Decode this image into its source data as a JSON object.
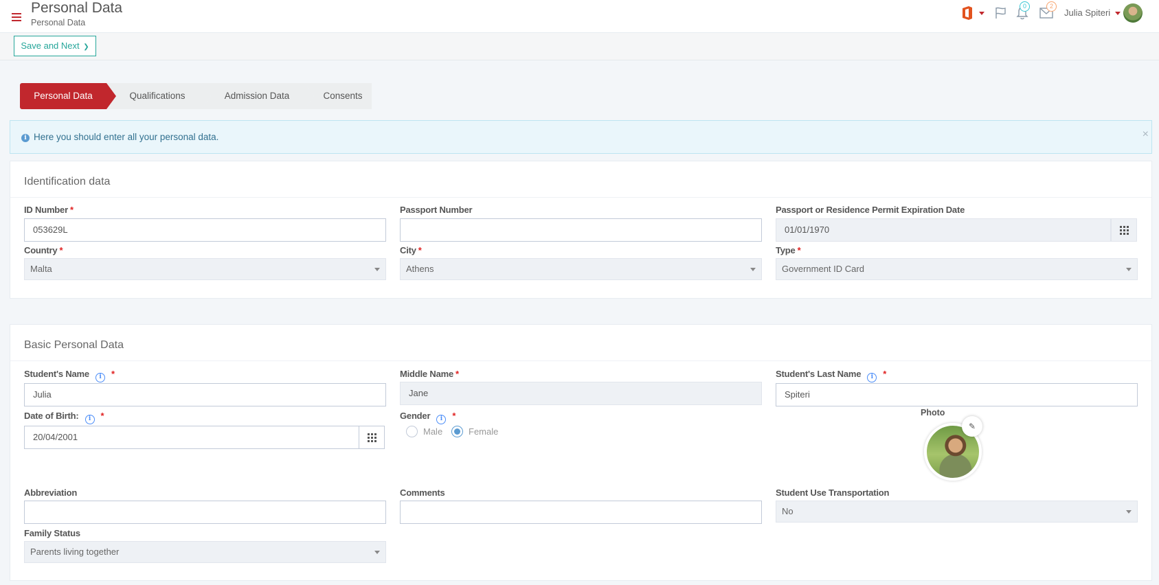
{
  "header": {
    "title": "Personal Data",
    "subtitle": "Personal Data",
    "notifications_count": "0",
    "messages_count": "2",
    "user_name": "Julia Spiteri",
    "icons": [
      "menu-icon",
      "office-icon",
      "flag-icon",
      "bell-icon",
      "mail-icon",
      "avatar"
    ]
  },
  "toolbar": {
    "save_next_label": "Save and Next",
    "save_next_glyph": "❯"
  },
  "steps": [
    {
      "label": "Personal Data",
      "active": true
    },
    {
      "label": "Qualifications",
      "active": false
    },
    {
      "label": "Admission Data",
      "active": false
    },
    {
      "label": "Consents",
      "active": false
    }
  ],
  "alert": {
    "text": "Here you should enter all your personal data.",
    "close": "×"
  },
  "identification": {
    "title": "Identification data",
    "id_number": {
      "label": "ID Number",
      "value": "053629L",
      "required": "*"
    },
    "passport_number": {
      "label": "Passport Number",
      "value": ""
    },
    "expiration": {
      "label": "Passport or Residence Permit Expiration Date",
      "value": "01/01/1970"
    },
    "country": {
      "label": "Country",
      "value": "Malta",
      "required": "*"
    },
    "city": {
      "label": "City",
      "value": "Athens",
      "required": "*"
    },
    "type": {
      "label": "Type",
      "value": "Government ID Card",
      "required": "*"
    }
  },
  "basic": {
    "title": "Basic Personal Data",
    "student_name": {
      "label": "Student's Name",
      "value": "Julia",
      "required": "*"
    },
    "middle_name": {
      "label": "Middle Name",
      "value": "Jane",
      "required": "*"
    },
    "last_name": {
      "label": "Student's Last Name",
      "value": "Spiteri",
      "required": "*"
    },
    "dob": {
      "label": "Date of Birth:",
      "value": "20/04/2001",
      "required": "*"
    },
    "gender": {
      "label": "Gender",
      "required": "*",
      "options": [
        "Male",
        "Female"
      ],
      "selected": "Female"
    },
    "photo_label": "Photo",
    "abbreviation": {
      "label": "Abbreviation",
      "value": ""
    },
    "comments": {
      "label": "Comments",
      "value": ""
    },
    "transportation": {
      "label": "Student Use Transportation",
      "value": "No"
    },
    "family_status": {
      "label": "Family Status",
      "value": "Parents living together"
    }
  },
  "colors": {
    "brand": "#c1272d",
    "accent": "#26a69a",
    "info": "#5b9bd1"
  }
}
